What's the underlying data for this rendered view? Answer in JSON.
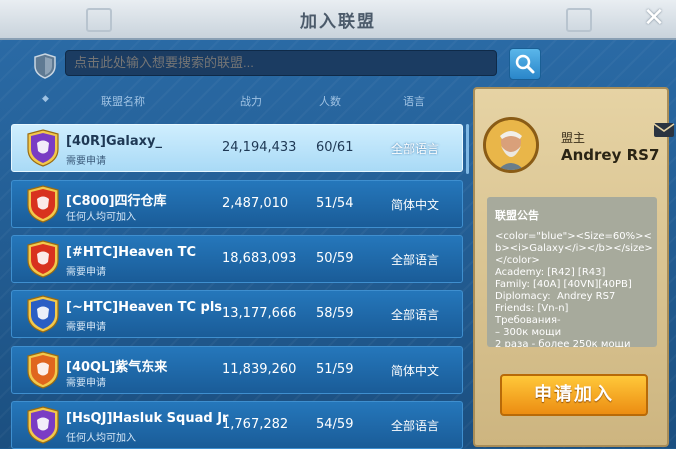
{
  "window": {
    "title": "加入联盟",
    "close_glyph": "✕"
  },
  "search": {
    "placeholder": "点击此处输入想要搜索的联盟..."
  },
  "columns": {
    "sort_glyph": "◆",
    "name": "联盟名称",
    "power": "战力",
    "members": "人数",
    "language": "语言"
  },
  "alliances": [
    {
      "name": "[40R]Galaxy_",
      "status": "需要申请",
      "power": "24,194,433",
      "members": "60/61",
      "language": "全部语言",
      "emblem_color": "#7a3cc4",
      "selected": true
    },
    {
      "name": "[C800]四行仓库",
      "status": "任何人均可加入",
      "power": "2,487,010",
      "members": "51/54",
      "language": "简体中文",
      "emblem_color": "#d8321e"
    },
    {
      "name": "[#HTC]Heaven TC",
      "status": "需要申请",
      "power": "18,683,093",
      "members": "50/59",
      "language": "全部语言",
      "emblem_color": "#d8321e"
    },
    {
      "name": "[~HTC]Heaven TC pls",
      "status": "需要申请",
      "power": "13,177,666",
      "members": "58/59",
      "language": "全部语言",
      "emblem_color": "#2a5ec4"
    },
    {
      "name": "[40QL]紫气东来",
      "status": "需要申请",
      "power": "11,839,260",
      "members": "51/59",
      "language": "简体中文",
      "emblem_color": "#e0661e"
    },
    {
      "name": "[HsQJ]Hasluk Squad Jr",
      "status": "任何人均可加入",
      "power": "1,767,282",
      "members": "54/59",
      "language": "全部语言",
      "emblem_color": "#7a3cc4"
    }
  ],
  "detail": {
    "leader_role": "盟主",
    "leader_name": "Andrey RS7",
    "notice_title": "联盟公告",
    "notice_body": "<color=\"blue\"><Size=60%><b><i>Galaxy</i></b></size></color>\nAcademy: [R42] [R43]\nFamily: [40A] [40VN][40PB]\nDiplomacy:  Andrey RS7\nFriends: [Vn-n]\nТребования-\n– 300к мощи\n2 раза - более 250к мощи",
    "join_button": "申请加入"
  }
}
